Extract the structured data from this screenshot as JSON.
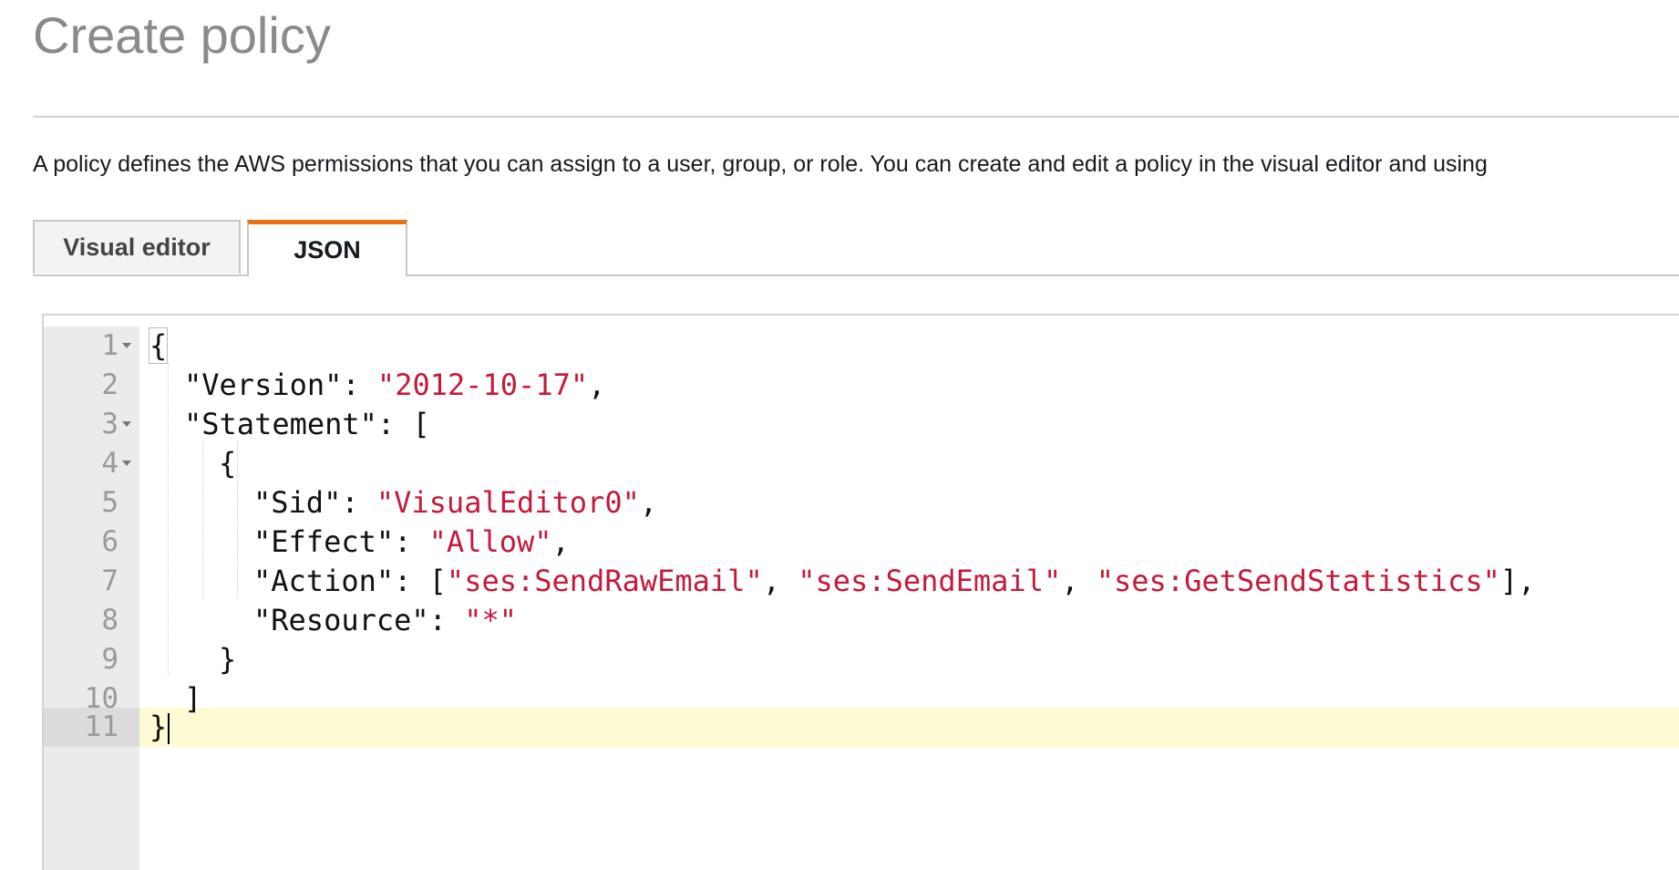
{
  "page": {
    "title": "Create policy",
    "description": "A policy defines the AWS permissions that you can assign to a user, group, or role. You can create and edit a policy in the visual editor and using"
  },
  "tabs": [
    {
      "label": "Visual editor",
      "active": false
    },
    {
      "label": "JSON",
      "active": true
    }
  ],
  "colors": {
    "active_tab_accent": "#ec7211",
    "string_color": "#c41a3b",
    "active_line_highlight": "#fdfbd3"
  },
  "editor": {
    "active_line": 11,
    "lines": [
      {
        "num": "1",
        "fold": true
      },
      {
        "num": "2",
        "fold": false
      },
      {
        "num": "3",
        "fold": true
      },
      {
        "num": "4",
        "fold": true
      },
      {
        "num": "5",
        "fold": false
      },
      {
        "num": "6",
        "fold": false
      },
      {
        "num": "7",
        "fold": false
      },
      {
        "num": "8",
        "fold": false
      },
      {
        "num": "9",
        "fold": false
      },
      {
        "num": "10",
        "fold": false
      },
      {
        "num": "11",
        "fold": false
      }
    ],
    "tokens": {
      "open_brace": "{",
      "version_key": "\"Version\": ",
      "version_value": "\"2012-10-17\"",
      "comma": ",",
      "statement_key": "\"Statement\": [",
      "inner_open": "{",
      "sid_key": "\"Sid\": ",
      "sid_value": "\"VisualEditor0\"",
      "effect_key": "\"Effect\": ",
      "effect_value": "\"Allow\"",
      "action_key": "\"Action\": [",
      "action_1": "\"ses:SendRawEmail\"",
      "action_2": "\"ses:SendEmail\"",
      "action_3": "\"ses:GetSendStatistics\"",
      "sep": ", ",
      "action_close": "],",
      "resource_key": "\"Resource\": ",
      "resource_value": "\"*\"",
      "inner_close": "}",
      "array_close": "]",
      "close_brace": "}"
    }
  }
}
